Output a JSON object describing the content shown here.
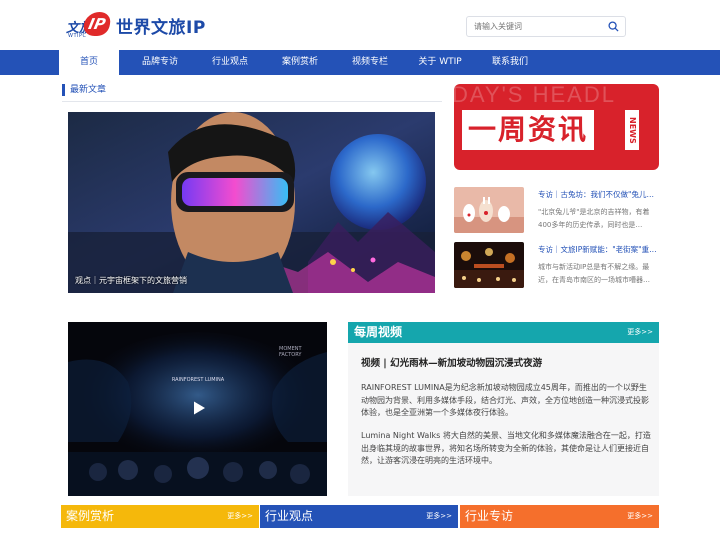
{
  "header": {
    "logo_mark_left": "文旅",
    "logo_mark_ip": "IP",
    "logo_mark_sub": "WTIPC",
    "logo_text": "世界文旅IP",
    "search_placeholder": "请输入关键词"
  },
  "nav": {
    "items": [
      "首页",
      "品牌专访",
      "行业观点",
      "案例赏析",
      "视频专栏",
      "关于 WTIP",
      "联系我们"
    ]
  },
  "latest": {
    "title": "最新文章",
    "hero_caption": "观点｜元宇宙框架下的文旅营销"
  },
  "banner": {
    "ghost": "DAY'S HEADL",
    "big": "一周资讯",
    "news": "NEWS"
  },
  "side_news": [
    {
      "title": "专访｜古兔坊：我们不仅做\"兔儿…",
      "desc": "\"北京兔儿爷\"是北京的吉祥物，有着400多年的历史传承，同时也是…"
    },
    {
      "title": "专访｜文旅IP新赋能：\"老街案\"重…",
      "desc": "城市与新活动IP总是有不解之缘。最近，在青岛市南区的一场城市嘈器…"
    }
  ],
  "video": {
    "overlay_top": "MOMENT FACTORY",
    "overlay_center": "RAINFOREST LUMINA"
  },
  "weekly": {
    "title": "每周视频",
    "more": "更多>>",
    "video_title": "视频 | 幻光雨林—新加坡动物园沉浸式夜游",
    "para1": "RAINFOREST LUMINA是为纪念新加坡动物园成立45周年，而推出的一个以野生动物园为背景、利用多媒体手段，结合灯光、声效，全方位地创造一种沉浸式投影体验，也是全亚洲第一个多媒体夜行体验。",
    "para2": "Lumina Night Walks 将大自然的美景、当地文化和多媒体魔法融合在一起，打造出身临其境的故事世界，将知名场所转变为全新的体验，其使命是让人们更接近自然，让游客沉浸在明亮的生活环境中。"
  },
  "bottom_bars": [
    {
      "title": "案例赏析",
      "more": "更多>>",
      "color": "#f5b80b"
    },
    {
      "title": "行业观点",
      "more": "更多>>",
      "color": "#2452b7"
    },
    {
      "title": "行业专访",
      "more": "更多>>",
      "color": "#f56f2c"
    }
  ],
  "colors": {
    "brand_blue": "#2452b7",
    "accent_red": "#d8222b",
    "teal": "#15a6ad"
  }
}
